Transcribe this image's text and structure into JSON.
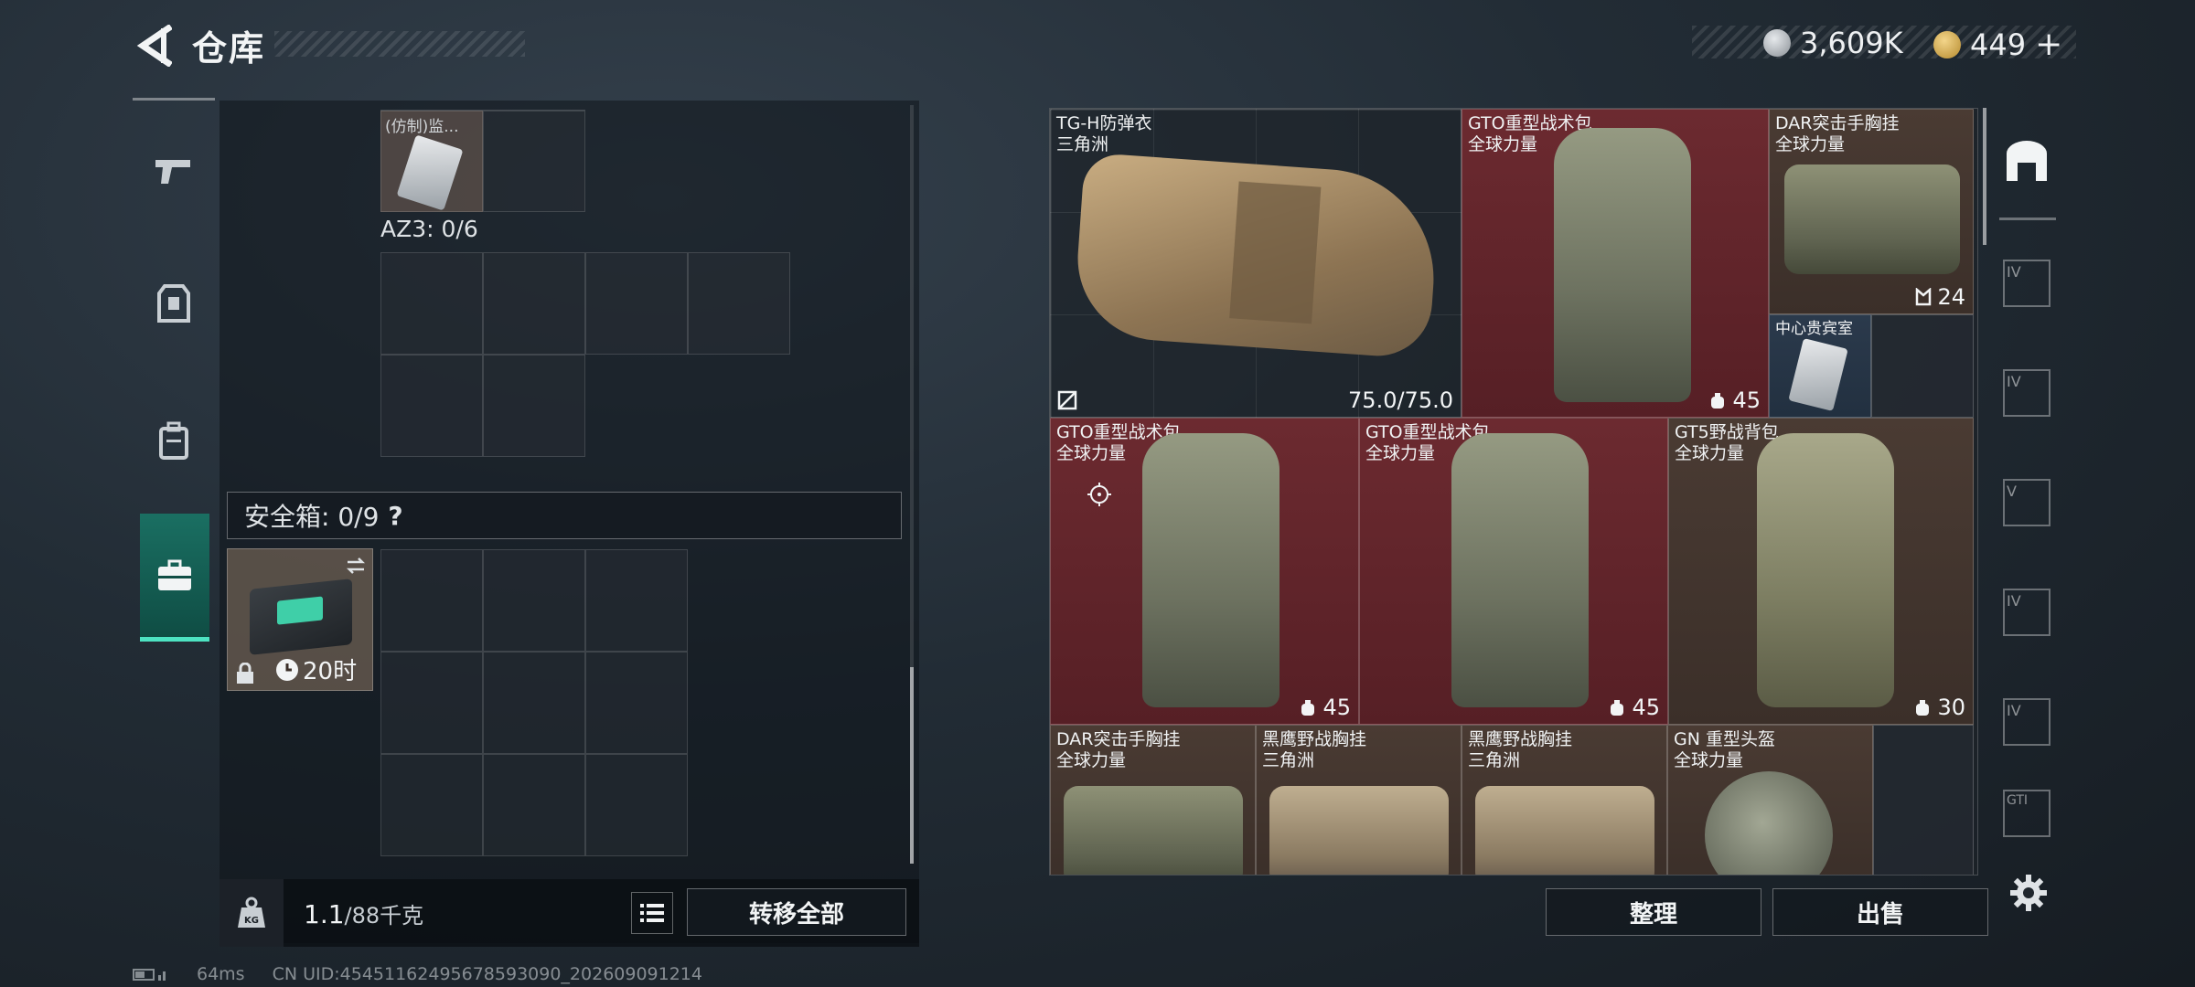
{
  "header": {
    "title": "仓库",
    "currency_silver": "3,609K",
    "currency_gold": "449",
    "add_label": "+"
  },
  "left_panel": {
    "top_item_name": "(仿制)监...",
    "az3_label": "AZ3: 0/6",
    "safe_box_label": "安全箱: 0/9",
    "help_label": "?",
    "safe_timer": "20时",
    "weight_current": "1.1",
    "weight_max": "/88千克",
    "transfer_all": "转移全部"
  },
  "stash": {
    "items": [
      {
        "name": "TG-H防弹衣",
        "sub": "三角洲",
        "stat": "75.0/75.0",
        "color": "blue"
      },
      {
        "name": "GTO重型战术包",
        "sub": "全球力量",
        "stat": "45",
        "color": "red"
      },
      {
        "name": "DAR突击手胸挂",
        "sub": "全球力量",
        "stat": "24",
        "color": "brown"
      },
      {
        "name": "中心贵宾室",
        "sub": "",
        "stat": "",
        "color": "blue"
      },
      {
        "name": "GTO重型战术包",
        "sub": "全球力量",
        "stat": "45",
        "color": "red"
      },
      {
        "name": "GTO重型战术包",
        "sub": "全球力量",
        "stat": "45",
        "color": "red"
      },
      {
        "name": "GT5野战背包",
        "sub": "全球力量",
        "stat": "30",
        "color": "brown"
      },
      {
        "name": "DAR突击手胸挂",
        "sub": "全球力量",
        "stat": "",
        "color": "brown"
      },
      {
        "name": "黑鹰野战胸挂",
        "sub": "三角洲",
        "stat": "",
        "color": "brown"
      },
      {
        "name": "黑鹰野战胸挂",
        "sub": "三角洲",
        "stat": "",
        "color": "brown"
      },
      {
        "name": "GN 重型头盔",
        "sub": "全球力量",
        "stat": "",
        "color": "brown"
      }
    ],
    "sort_label": "整理",
    "sell_label": "出售"
  },
  "right_tabs": [
    "IV",
    "IV",
    "V",
    "IV",
    "IV",
    "GTI"
  ],
  "footer": {
    "ping": "64ms",
    "uid": "CN UID:4545116249567859309​0_202609091214"
  },
  "colors": {
    "accent": "#4de3c2",
    "red_item": "#6c2a30",
    "blue_item": "#2b3a4c"
  }
}
